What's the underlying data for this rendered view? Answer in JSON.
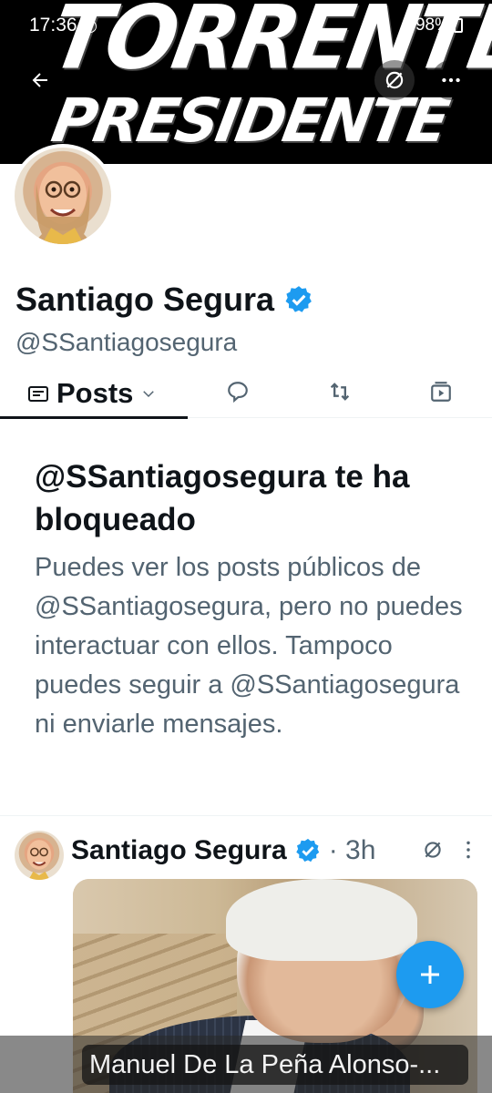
{
  "status_bar": {
    "time": "17:36",
    "battery": "98%"
  },
  "banner": {
    "line1": "TORRENTE",
    "line2": "PRESIDENTE"
  },
  "header": {
    "back_icon": "arrow-left-icon",
    "grok_icon": "grok-icon",
    "more_icon": "more-horizontal-icon"
  },
  "profile": {
    "name": "Santiago Segura",
    "handle": "@SSantiagosegura",
    "verified": true,
    "verified_color": "#1d9bf0"
  },
  "tabs": {
    "posts_label": "Posts",
    "icons": [
      "reply-icon",
      "repost-icon",
      "media-icon"
    ]
  },
  "blocked": {
    "title": "@SSantiagosegura te ha bloqueado",
    "body": "Puedes ver los posts públicos de @SSantiagosegura, pero no puedes interactuar con ellos. Tampoco puedes seguir a @SSantiagosegura ni enviarle mensajes."
  },
  "post": {
    "author": "Santiago Segura",
    "time": "· 3h"
  },
  "fab": {
    "icon": "plus-icon",
    "color": "#1d9bf0"
  },
  "caption": {
    "text": "Manuel De La Peña Alonso-..."
  }
}
